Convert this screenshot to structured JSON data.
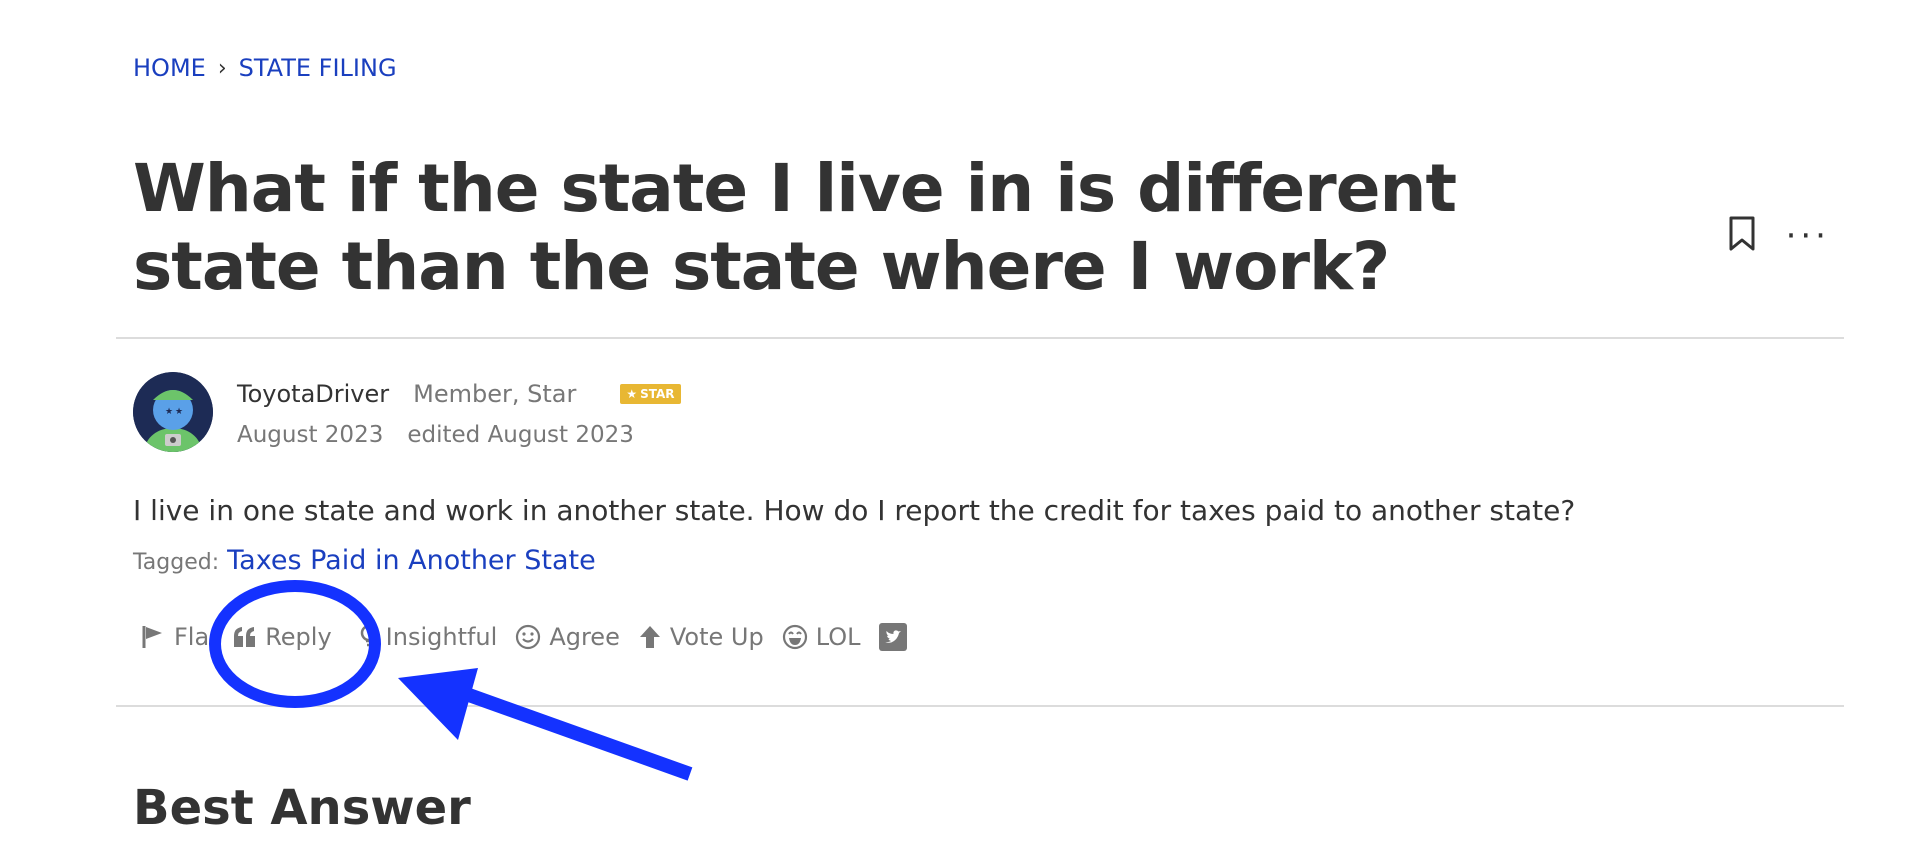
{
  "breadcrumb": {
    "home": "HOME",
    "separator": "›",
    "current": "STATE FILING"
  },
  "question": {
    "title": "What if the state I live in is different state than the state where I work?",
    "body": "I live in one state and work in another state. How do I report the credit for taxes paid to another state?"
  },
  "author": {
    "name": "ToyotaDriver",
    "role": "Member, Star",
    "badge": "STAR",
    "date": "August 2023",
    "edited": "edited August 2023"
  },
  "tags": {
    "label": "Tagged:",
    "items": [
      "Taxes Paid in Another State"
    ]
  },
  "reactions": [
    {
      "label": "Fla",
      "icon": "flag-icon"
    },
    {
      "label": "Reply",
      "icon": "quote-icon"
    },
    {
      "label": "Insightful",
      "icon": "lightbulb-icon"
    },
    {
      "label": "Agree",
      "icon": "smile-icon"
    },
    {
      "label": "Vote Up",
      "icon": "arrow-up-icon"
    },
    {
      "label": "LOL",
      "icon": "laugh-icon"
    }
  ],
  "section": {
    "best_answer": "Best Answer"
  },
  "colors": {
    "link": "#1a3fbf",
    "annotation": "#1432ff",
    "badge": "#e8b733"
  }
}
